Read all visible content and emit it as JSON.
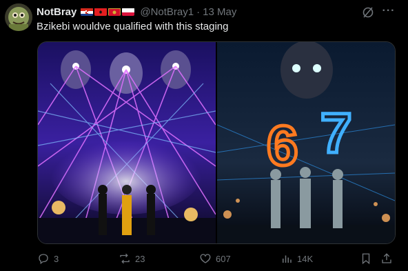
{
  "tweet": {
    "name": "NotBray",
    "handle": "@NotBray1",
    "separator": "·",
    "date": "13 May",
    "text": "Bzikebi wouldve qualified with this staging",
    "more_label": "···"
  },
  "flags": [
    "croatia-flag",
    "albania-flag",
    "montenegro-flag",
    "poland-flag"
  ],
  "media": {
    "right_panel_digits": [
      "6",
      "7"
    ]
  },
  "actions": {
    "replies": "3",
    "reposts": "23",
    "likes": "607",
    "views": "14K"
  },
  "colors": {
    "background": "#000000",
    "primary_text": "#e7e9ea",
    "secondary_text": "#71767b",
    "border": "#2f3336"
  }
}
